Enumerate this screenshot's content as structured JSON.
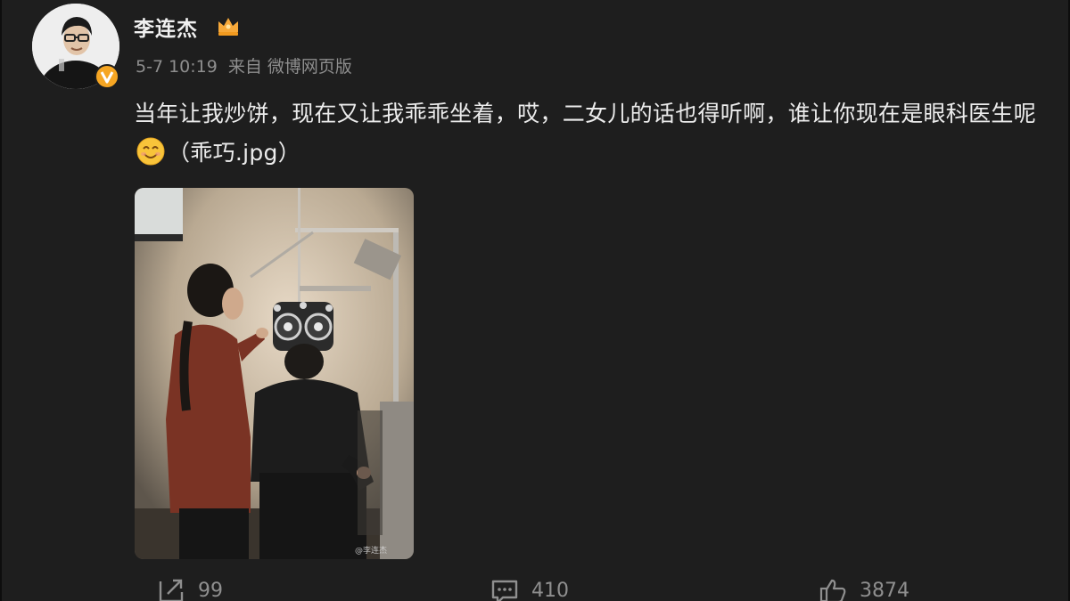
{
  "user": {
    "name": "李连杰",
    "verified_badge": "V",
    "badge_color": "#f6a623",
    "member_icon": "crown-icon"
  },
  "post": {
    "time": "5-7 10:19",
    "source_prefix": "来自",
    "source": "微博网页版",
    "text_main": "当年让我炒饼，现在又让我乖乖坐着，哎，二女儿的话也得听啊，谁让你现在是眼科医生呢",
    "emoji": "smile-emoji",
    "text_tail": "（乖巧.jpg）",
    "photo_watermark": "@李连杰"
  },
  "actions": {
    "repost_count": "99",
    "comment_count": "410",
    "like_count": "3874"
  },
  "colors": {
    "background": "#1e1e1e",
    "text": "#ececec",
    "meta": "#8e8e8e",
    "action": "#8f8f8f"
  }
}
